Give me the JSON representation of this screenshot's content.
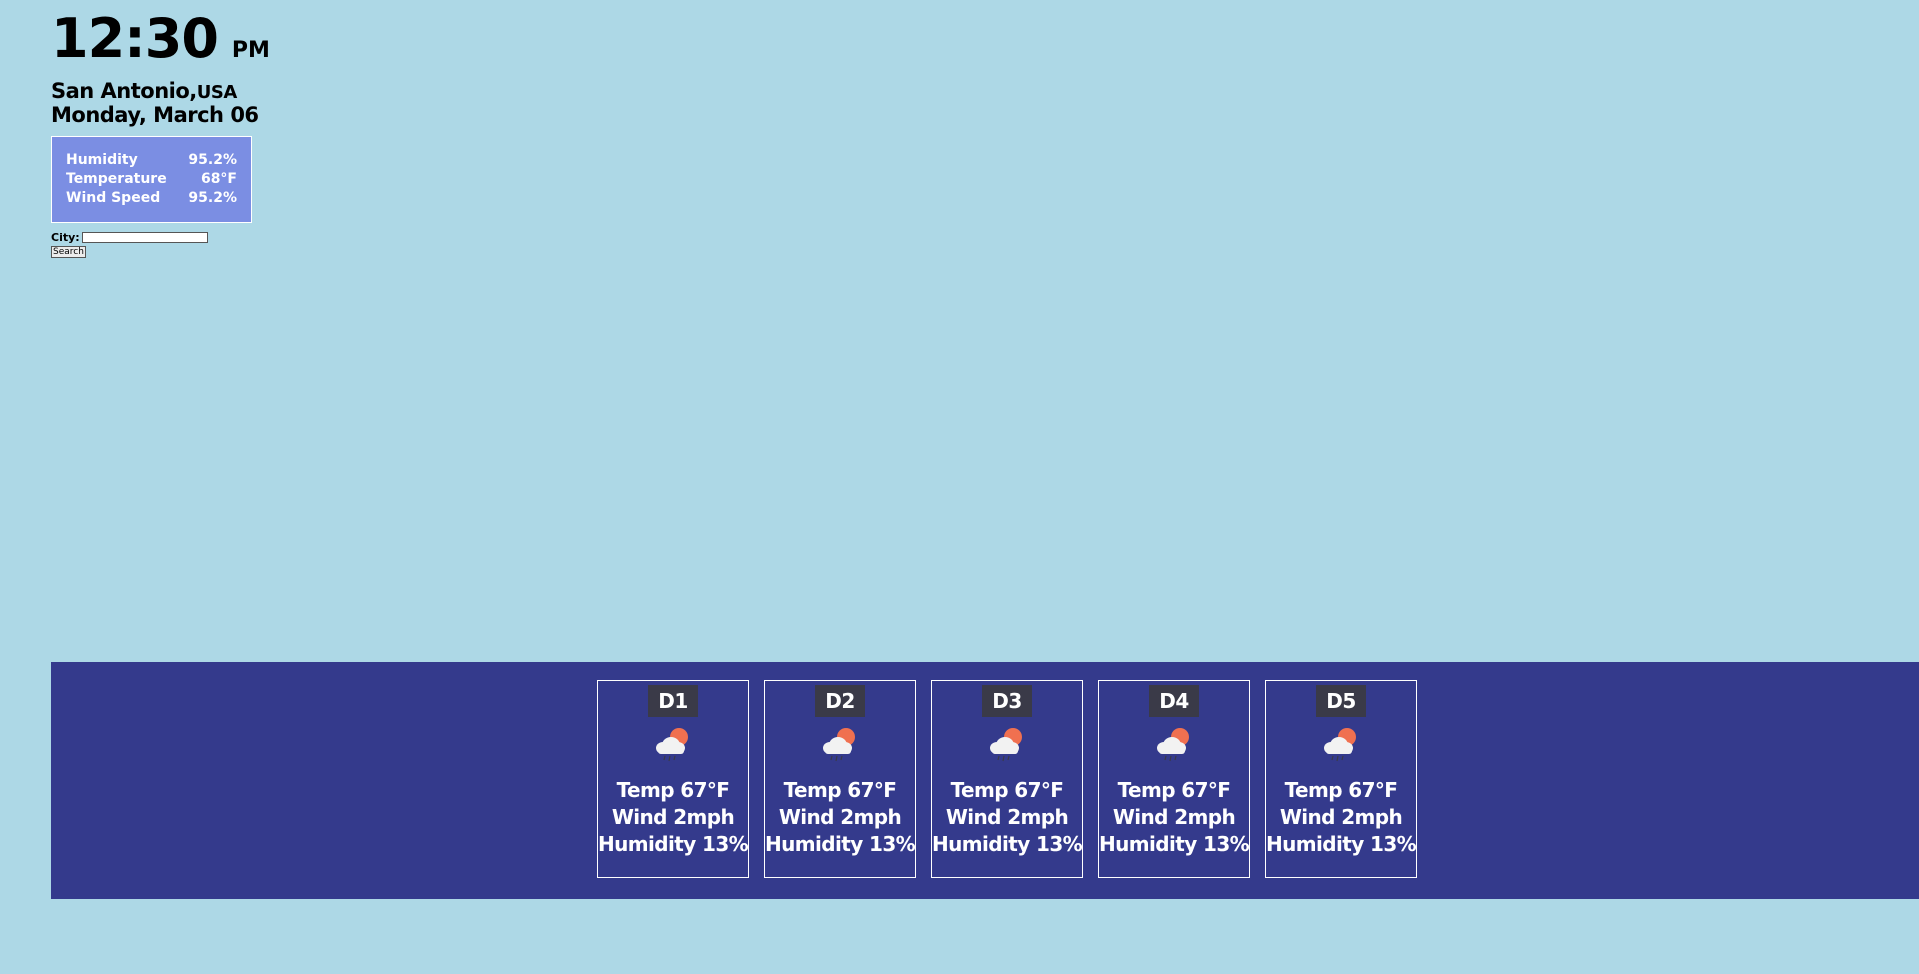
{
  "current": {
    "time": "12:30",
    "ampm": "PM",
    "city": "San Antonio,",
    "country": "USA",
    "date": "Monday, March 06",
    "stats": [
      {
        "label": "Humidity",
        "value": "95.2%"
      },
      {
        "label": "Temperature",
        "value": "68°F"
      },
      {
        "label": "Wind Speed",
        "value": "95.2%"
      }
    ]
  },
  "search": {
    "label": "City:",
    "value": "",
    "button_label": "Search"
  },
  "forecast": {
    "days": [
      {
        "label": "D1",
        "icon": "cloud-sun-rain-icon",
        "temp": "Temp 67°F",
        "wind": "Wind 2mph",
        "humidity": "Humidity 13%"
      },
      {
        "label": "D2",
        "icon": "cloud-sun-rain-icon",
        "temp": "Temp 67°F",
        "wind": "Wind 2mph",
        "humidity": "Humidity 13%"
      },
      {
        "label": "D3",
        "icon": "cloud-sun-rain-icon",
        "temp": "Temp 67°F",
        "wind": "Wind 2mph",
        "humidity": "Humidity 13%"
      },
      {
        "label": "D4",
        "icon": "cloud-sun-rain-icon",
        "temp": "Temp 67°F",
        "wind": "Wind 2mph",
        "humidity": "Humidity 13%"
      },
      {
        "label": "D5",
        "icon": "cloud-sun-rain-icon",
        "temp": "Temp 67°F",
        "wind": "Wind 2mph",
        "humidity": "Humidity 13%"
      }
    ]
  },
  "colors": {
    "page_background": "#add8e6",
    "stats_panel": "#7b8ee3",
    "forecast_band": "#343a8c",
    "day_label_bg": "#3a3a48",
    "sun": "#f07050",
    "cloud": "#f2f2f2"
  }
}
